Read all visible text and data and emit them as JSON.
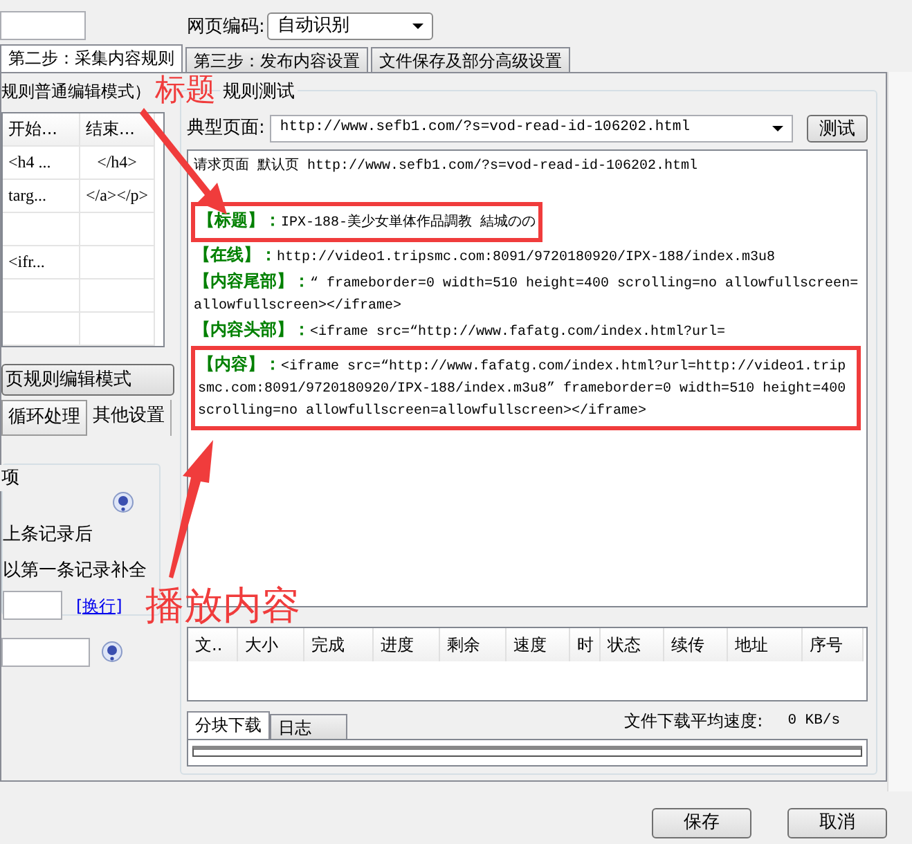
{
  "encoding": {
    "label": "网页编码:",
    "value": "自动识别"
  },
  "tabs": [
    {
      "label": "第二步：采集内容规则",
      "selected": true
    },
    {
      "label": "第三步：发布内容设置",
      "selected": false
    },
    {
      "label": "文件保存及部分高级设置",
      "selected": false
    }
  ],
  "left_panel": {
    "mode_header": "规则普通编辑模式）",
    "rules_table": {
      "columns": [
        "开始...",
        "结束..."
      ],
      "rows": [
        {
          "start": "<h4 ...",
          "end": "</h4>"
        },
        {
          "start": "targ...",
          "end": "</a></p>"
        },
        {},
        {
          "start": "<ifr..."
        }
      ]
    },
    "mode_button": "页规则编辑模式",
    "sub_tabs": [
      {
        "label": "循环处理",
        "selected": true
      },
      {
        "label": "其他设置",
        "selected": false
      }
    ],
    "group_title": "项",
    "options": [
      "上条记录后",
      "以第一条记录补全"
    ],
    "link": "[换行]"
  },
  "test_panel": {
    "title": "规则测试",
    "page_label": "典型页面:",
    "page_url": "http://www.sefb1.com/?s=vod-read-id-106202.html",
    "test_button": "测试",
    "output": {
      "request_line": "请求页面 默认页 http://www.sefb1.com/?s=vod-read-id-106202.html",
      "fields": [
        {
          "label": "【标题】：",
          "value": "IPX-188-美少女単体作品調教 結城のの",
          "boxed": true
        },
        {
          "label": "【在线】：",
          "value": "http://video1.tripsmc.com:8091/9720180920/IPX-188/index.m3u8",
          "boxed": false
        },
        {
          "label": "【内容尾部】：",
          "value": "“ frameborder=0 width=510 height=400 scrolling=no allowfullscreen=allowfullscreen></iframe>",
          "boxed": false
        },
        {
          "label": "【内容头部】：",
          "value": "<iframe src=“http://www.fafatg.com/index.html?url=",
          "boxed": false
        },
        {
          "label": "【内容】：",
          "value": "<iframe src=“http://www.fafatg.com/index.html?url=http://video1.tripsmc.com:8091/9720180920/IPX-188/index.m3u8” frameborder=0 width=510 height=400 scrolling=no allowfullscreen=allowfullscreen></iframe>",
          "boxed": true
        }
      ]
    }
  },
  "download": {
    "columns": [
      "文..",
      "大小",
      "完成",
      "进度",
      "剩余",
      "速度",
      "时",
      "状态",
      "续传",
      "地址",
      "序号"
    ],
    "tabs": [
      {
        "label": "分块下载",
        "selected": true
      },
      {
        "label": "日志",
        "selected": false
      }
    ],
    "speed_label": "文件下载平均速度:",
    "speed_value": "0 KB/s",
    "progress": {
      "level": 0
    }
  },
  "buttons": [
    "保存",
    "取消"
  ],
  "annotations": [
    {
      "text": "标题"
    },
    {
      "text": "播放内容"
    }
  ]
}
